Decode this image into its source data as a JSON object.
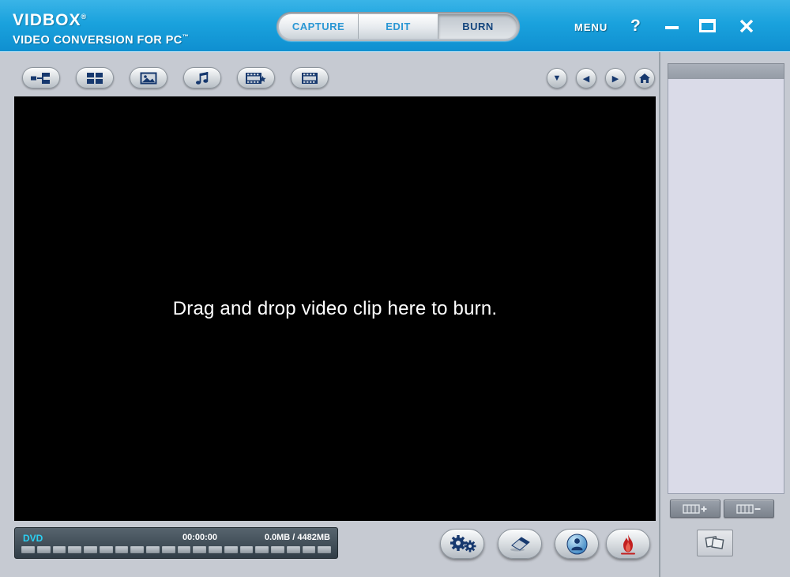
{
  "header": {
    "logo_title": "VIDBOX",
    "logo_reg_mark": "®",
    "logo_subtitle": "VIDEO CONVERSION FOR PC",
    "logo_tm_mark": "™",
    "tabs": [
      {
        "label": "CAPTURE",
        "active": false
      },
      {
        "label": "EDIT",
        "active": false
      },
      {
        "label": "BURN",
        "active": true
      }
    ],
    "menu_label": "MENU",
    "help_label": "?"
  },
  "toolbar": {
    "nav_glyphs": {
      "down": "▼",
      "left": "◀",
      "right": "▶"
    }
  },
  "preview": {
    "drop_message": "Drag and drop video clip here to burn."
  },
  "status_bar": {
    "disc_type": "DVD",
    "elapsed_time": "00:00:00",
    "capacity": "0.0MB / 4482MB",
    "meter_segments": 20
  },
  "colors": {
    "header_blue": "#1aa2dd",
    "icon_navy": "#16386e",
    "disc_cyan": "#2bd0f2",
    "flame_red": "#c21f1f",
    "panel_lavender": "#dadbe8"
  }
}
